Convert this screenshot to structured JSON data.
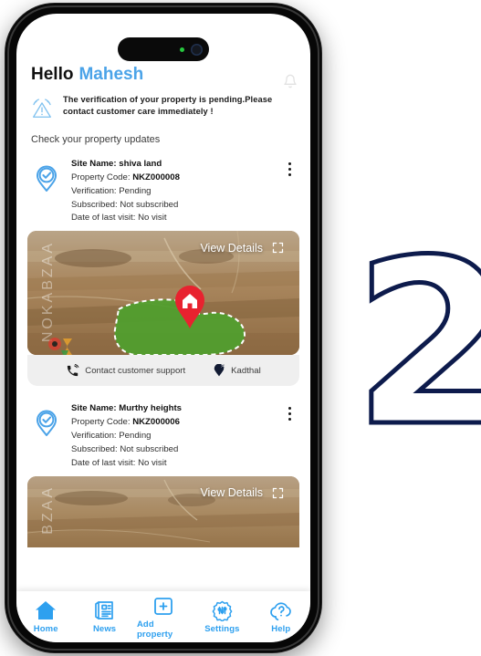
{
  "brand": {
    "accent_blue": "#4ba3e8",
    "nav_blue": "#2ea0ef",
    "numeral_navy": "#0d1b4c",
    "plot_green": "#4f9f2e",
    "pin_red": "#e8222f"
  },
  "decoration": {
    "slide_number": "2"
  },
  "header": {
    "greeting": "Hello",
    "user_name": "Mahesh",
    "notification_icon": "bell-icon"
  },
  "alert": {
    "icon": "warning-triangle-icon",
    "message": "The verification of your property is pending.Please contact customer care immediately !"
  },
  "section": {
    "title": "Check your property updates"
  },
  "cards": [
    {
      "status_icon": "map-pin-check-icon",
      "menu_icon": "more-vertical-icon",
      "site_name_label": "Site Name:",
      "site_name_value": "shiva land",
      "property_code_label": "Property Code:",
      "property_code_value": "NKZ000008",
      "verification_label": "Verification:",
      "verification_value": "Pending",
      "subscribed_label": "Subscribed:",
      "subscribed_value": "Not subscribed",
      "last_visit_label": "Date of last visit:",
      "last_visit_value": "No visit",
      "media": {
        "view_details_label": "View Details",
        "view_details_icon": "expand-corners-icon",
        "watermark": "NOKABZAA",
        "plot_pin_icon": "home-marker-icon"
      },
      "footer": {
        "support_label": "Contact customer support",
        "support_icon": "phone-ringing-icon",
        "location_label": "Kadthal",
        "location_icon": "map-pin-icon"
      }
    },
    {
      "status_icon": "map-pin-check-icon",
      "menu_icon": "more-vertical-icon",
      "site_name_label": "Site Name:",
      "site_name_value": "Murthy heights",
      "property_code_label": "Property Code:",
      "property_code_value": "NKZ000006",
      "verification_label": "Verification:",
      "verification_value": "Pending",
      "subscribed_label": "Subscribed:",
      "subscribed_value": "Not subscribed",
      "last_visit_label": "Date of last visit:",
      "last_visit_value": "No visit",
      "media": {
        "view_details_label": "View Details",
        "view_details_icon": "expand-corners-icon",
        "watermark": "BZAA"
      }
    }
  ],
  "navbar": {
    "items": [
      {
        "label": "Home",
        "icon": "home-icon",
        "active": true
      },
      {
        "label": "News",
        "icon": "newspaper-icon",
        "active": false
      },
      {
        "label": "Add property",
        "icon": "plus-square-icon",
        "active": false
      },
      {
        "label": "Settings",
        "icon": "gear-sliders-icon",
        "active": false
      },
      {
        "label": "Help",
        "icon": "help-cloud-icon",
        "active": false
      }
    ]
  }
}
